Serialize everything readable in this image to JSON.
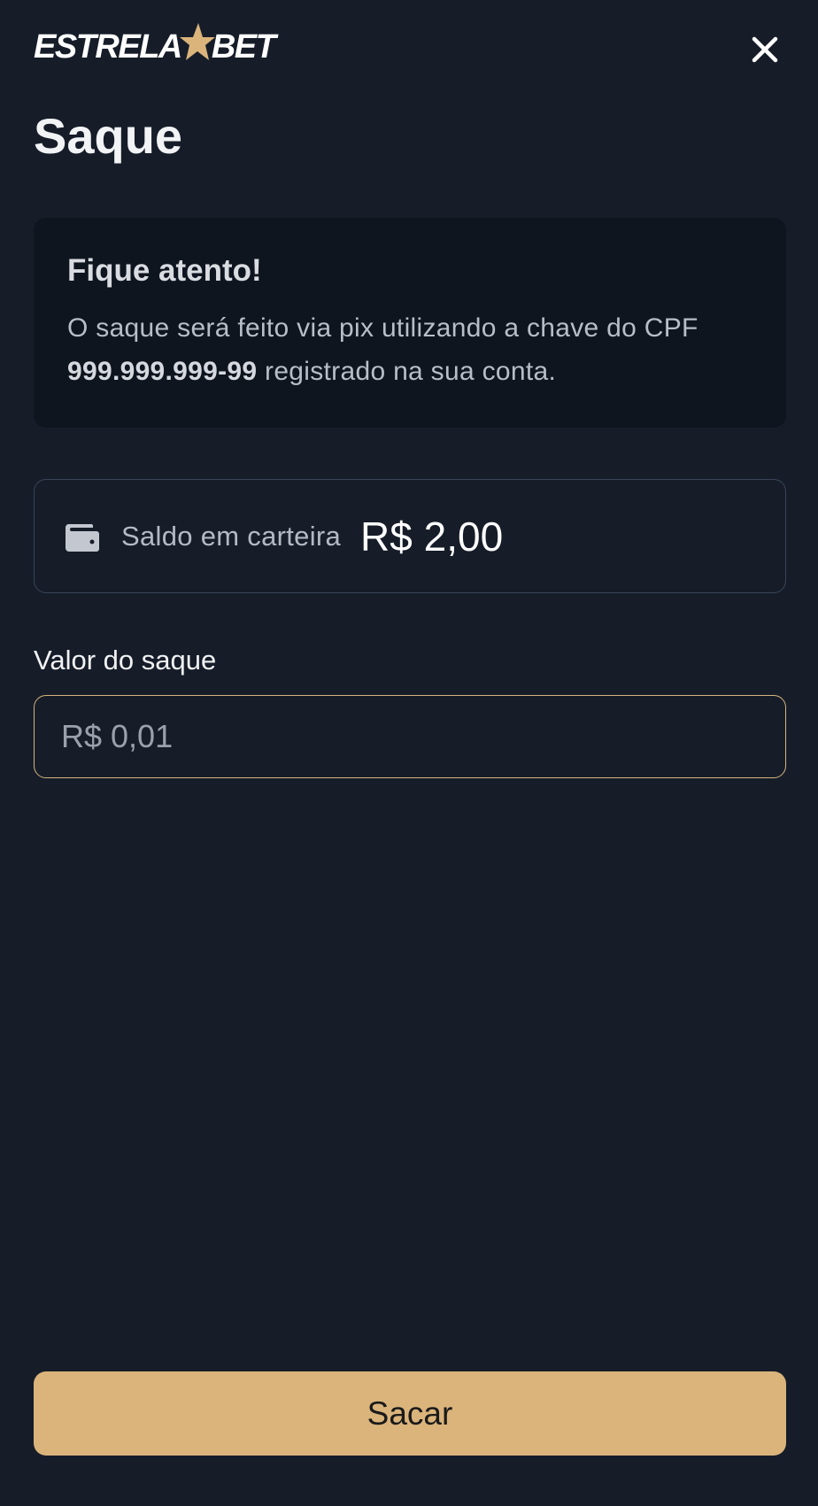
{
  "brand": {
    "name_left": "ESTRELA",
    "name_right": "BET",
    "accent_color": "#dbb47b"
  },
  "header": {
    "close_icon": "close-icon"
  },
  "page": {
    "title": "Saque"
  },
  "notice": {
    "title": "Fique atento!",
    "text_before": "O saque será feito via pix utilizando a chave do CPF ",
    "cpf": "999.999.999-99",
    "text_after": " registrado na sua conta."
  },
  "wallet": {
    "icon": "wallet-icon",
    "label": "Saldo em carteira",
    "value": "R$ 2,00"
  },
  "withdraw": {
    "label": "Valor do saque",
    "placeholder": "R$ 0,01",
    "value": ""
  },
  "actions": {
    "submit_label": "Sacar"
  }
}
